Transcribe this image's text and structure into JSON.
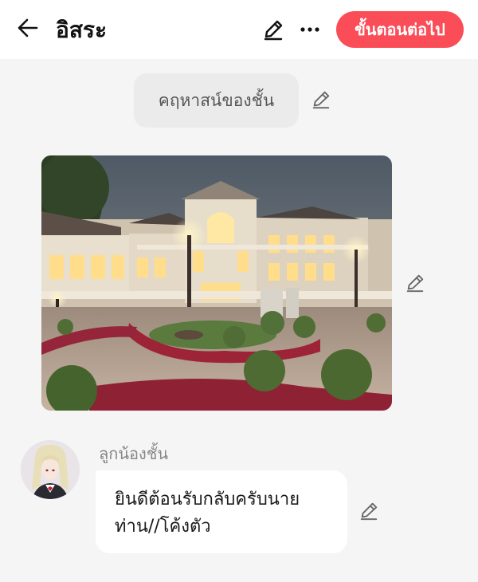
{
  "header": {
    "title": "อิสระ",
    "next_label": "ขั้นตอนต่อไป",
    "icons": [
      "back-arrow-icon",
      "pencil-icon",
      "more-dots-icon"
    ],
    "accent_color": "#fa4d58"
  },
  "scene": {
    "label": "คฤหาสน์ของชั้น",
    "edit_icon": "pencil-icon"
  },
  "image": {
    "subject": "mansion at dusk"
  },
  "message": {
    "character_name": "ลูกน้องชั้น",
    "line1": "ยินดีต้อนรับกลับครับนาย",
    "line2": "ท่าน//โค้งตัว",
    "edit_icon": "pencil-icon"
  }
}
